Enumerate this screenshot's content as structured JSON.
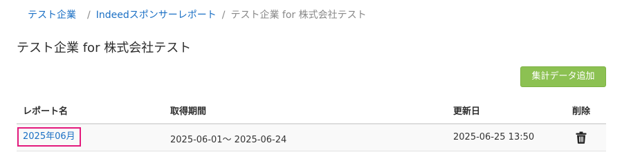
{
  "breadcrumb": {
    "items": [
      {
        "label": "テスト企業",
        "link": true
      },
      {
        "label": "Indeedスポンサーレポート",
        "link": true
      },
      {
        "label": "テスト企業 for 株式会社テスト",
        "link": false
      }
    ],
    "separator": "/"
  },
  "page": {
    "title": "テスト企業 for 株式会社テスト"
  },
  "toolbar": {
    "add_label": "集計データ追加"
  },
  "table": {
    "headers": {
      "name": "レポート名",
      "period": "取得期間",
      "updated": "更新日",
      "delete": "削除"
    },
    "rows": [
      {
        "name": "2025年06月",
        "period": "2025-06-01～ 2025-06-24",
        "updated": "2025-06-25 13:50",
        "delete_icon": "trash-icon"
      }
    ]
  },
  "colors": {
    "link": "#1a6fc4",
    "button_green": "#8cc152",
    "highlight_border": "#e3197c"
  }
}
